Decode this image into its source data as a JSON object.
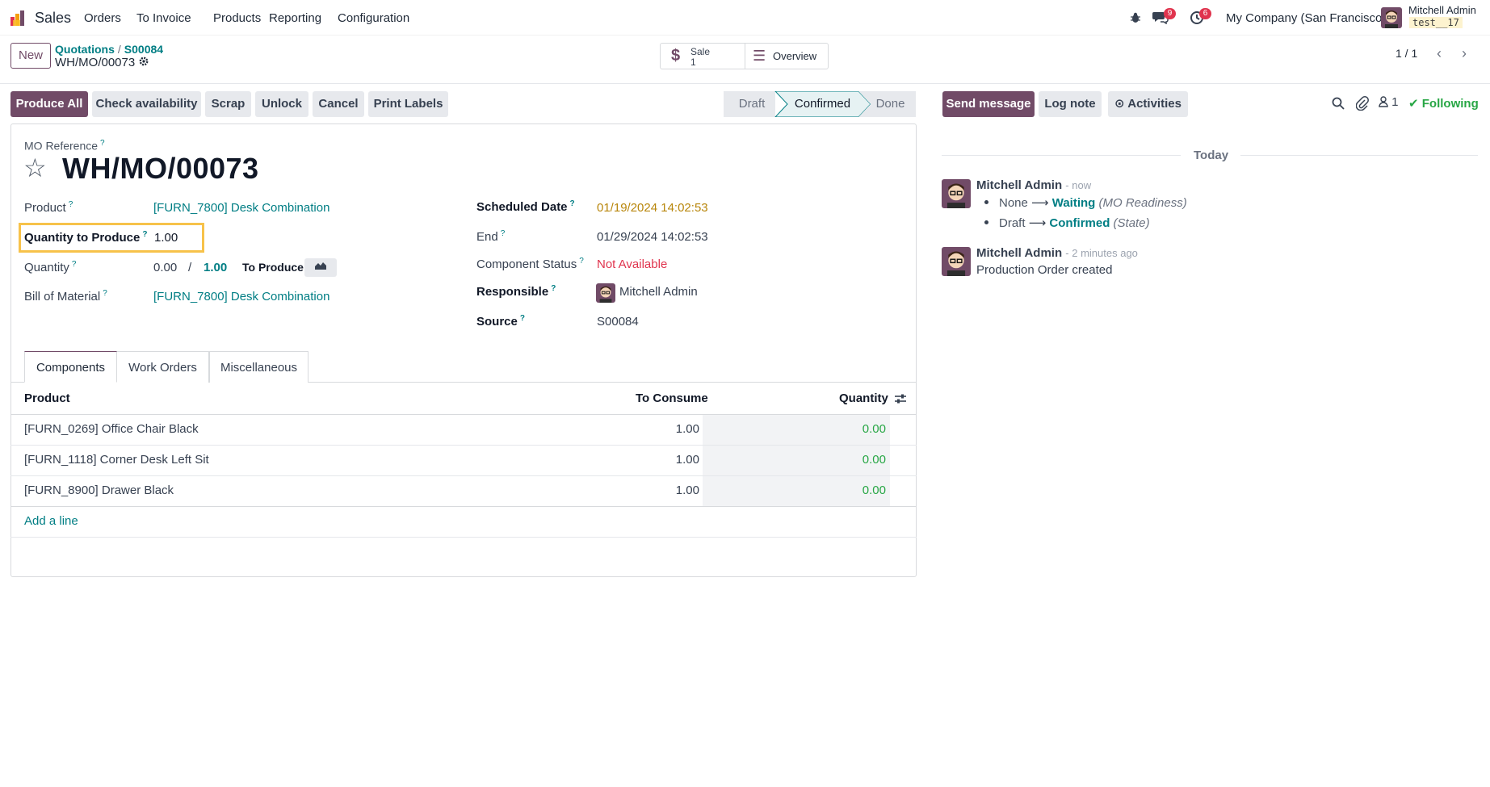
{
  "navbar": {
    "app_name": "Sales",
    "menu": [
      "Orders",
      "To Invoice",
      "Products",
      "Reporting",
      "Configuration"
    ],
    "messages_badge": "9",
    "activities_badge": "6",
    "company": "My Company (San Francisco)",
    "user_name": "Mitchell Admin",
    "db_name": "test__17"
  },
  "control_panel": {
    "new_label": "New",
    "breadcrumb": [
      "Quotations",
      "S00084"
    ],
    "record_name": "WH/MO/00073",
    "smart_sale_title": "Sale",
    "smart_sale_count": "1",
    "smart_overview": "Overview",
    "pager": "1 / 1"
  },
  "actions": {
    "produce_all": "Produce All",
    "check_availability": "Check availability",
    "scrap": "Scrap",
    "unlock": "Unlock",
    "cancel": "Cancel",
    "print_labels": "Print Labels"
  },
  "stages": [
    "Draft",
    "Confirmed",
    "Done"
  ],
  "active_stage": "Confirmed",
  "form": {
    "ref_label": "MO Reference",
    "mo_name": "WH/MO/00073",
    "product_label": "Product",
    "product_value": "[FURN_7800] Desk Combination",
    "qty_to_produce_label": "Quantity to Produce",
    "qty_to_produce_value": "1.00",
    "quantity_label": "Quantity",
    "quantity_done": "0.00",
    "quantity_slash": "/",
    "quantity_total": "1.00",
    "to_produce_label": "To Produce",
    "bom_label": "Bill of Material",
    "bom_value": "[FURN_7800] Desk Combination",
    "scheduled_label": "Scheduled Date",
    "scheduled_value": "01/19/2024 14:02:53",
    "end_label": "End",
    "end_value": "01/29/2024 14:02:53",
    "component_status_label": "Component Status",
    "component_status_value": "Not Available",
    "responsible_label": "Responsible",
    "responsible_value": "Mitchell Admin",
    "source_label": "Source",
    "source_value": "S00084"
  },
  "tabs": [
    "Components",
    "Work Orders",
    "Miscellaneous"
  ],
  "table": {
    "headers": {
      "product": "Product",
      "to_consume": "To Consume",
      "quantity": "Quantity"
    },
    "rows": [
      {
        "product": "[FURN_0269] Office Chair Black",
        "to_consume": "1.00",
        "quantity": "0.00"
      },
      {
        "product": "[FURN_1118] Corner Desk Left Sit",
        "to_consume": "1.00",
        "quantity": "0.00"
      },
      {
        "product": "[FURN_8900] Drawer Black",
        "to_consume": "1.00",
        "quantity": "0.00"
      }
    ],
    "add_line": "Add a line"
  },
  "chatter": {
    "send_message": "Send message",
    "log_note": "Log note",
    "activities": "Activities",
    "followers_count": "1",
    "following": "Following",
    "today": "Today",
    "messages": [
      {
        "author": "Mitchell Admin",
        "time": "- now",
        "tracking": [
          {
            "old": "None",
            "new": "Waiting",
            "field": "(MO Readiness)"
          },
          {
            "old": "Draft",
            "new": "Confirmed",
            "field": "(State)"
          }
        ]
      },
      {
        "author": "Mitchell Admin",
        "time": "- 2 minutes ago",
        "body": "Production Order created"
      }
    ]
  },
  "colors": {
    "primary": "#714b67",
    "link": "#017e84",
    "danger": "#e0344e",
    "success": "#28a745",
    "warning_date": "#b8860b",
    "highlight": "#f7c24a"
  }
}
